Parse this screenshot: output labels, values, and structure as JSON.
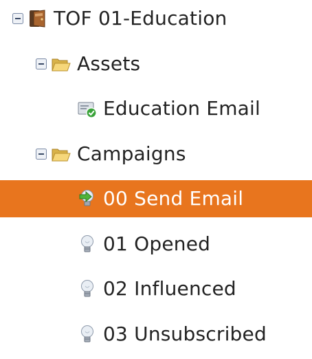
{
  "tree": {
    "root": {
      "label": "TOF 01-Education",
      "icon": "program-folder-icon",
      "expanded": true
    },
    "assets_folder": {
      "label": "Assets",
      "icon": "folder-open-icon",
      "expanded": true
    },
    "asset_items": [
      {
        "label": "Education Email",
        "icon": "approved-email-icon"
      }
    ],
    "campaigns_folder": {
      "label": "Campaigns",
      "icon": "folder-open-icon",
      "expanded": true
    },
    "campaign_items": [
      {
        "label": "00 Send Email",
        "icon": "active-campaign-icon",
        "selected": true
      },
      {
        "label": "01 Opened",
        "icon": "lightbulb-icon",
        "selected": false
      },
      {
        "label": "02 Influenced",
        "icon": "lightbulb-icon",
        "selected": false
      },
      {
        "label": "03 Unsubscribed",
        "icon": "lightbulb-icon",
        "selected": false
      }
    ]
  },
  "colors": {
    "selection": "#e8751e",
    "selected_text": "#ffffff",
    "text": "#222222"
  }
}
